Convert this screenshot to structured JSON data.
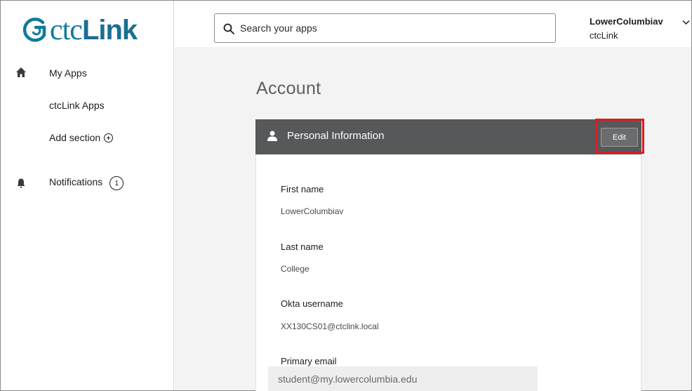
{
  "brand": {
    "logo_ctc": "ctc",
    "logo_link": "Link",
    "logo_color": "#0f7a9e"
  },
  "sidebar": {
    "items": [
      {
        "label": "My Apps",
        "icon": "home-icon"
      },
      {
        "label": "ctcLink Apps"
      },
      {
        "label": "Add section",
        "icon": "plus-circle-icon"
      },
      {
        "label": "Notifications",
        "icon": "bell-icon",
        "count": "1"
      }
    ]
  },
  "header": {
    "search_placeholder": "Search your apps",
    "user_name": "LowerColumbiav",
    "user_org": "ctcLink"
  },
  "page": {
    "title": "Account"
  },
  "card": {
    "title": "Personal Information",
    "edit_label": "Edit",
    "header_color": "#57585a",
    "highlight_color": "#d81e21",
    "fields": [
      {
        "label": "First name",
        "value": "LowerColumbiav"
      },
      {
        "label": "Last name",
        "value": "College"
      },
      {
        "label": "Okta username",
        "value": "XX130CS01@ctclink.local"
      },
      {
        "label": "Primary email",
        "value": "student@my.lowercolumbia.edu"
      }
    ]
  }
}
